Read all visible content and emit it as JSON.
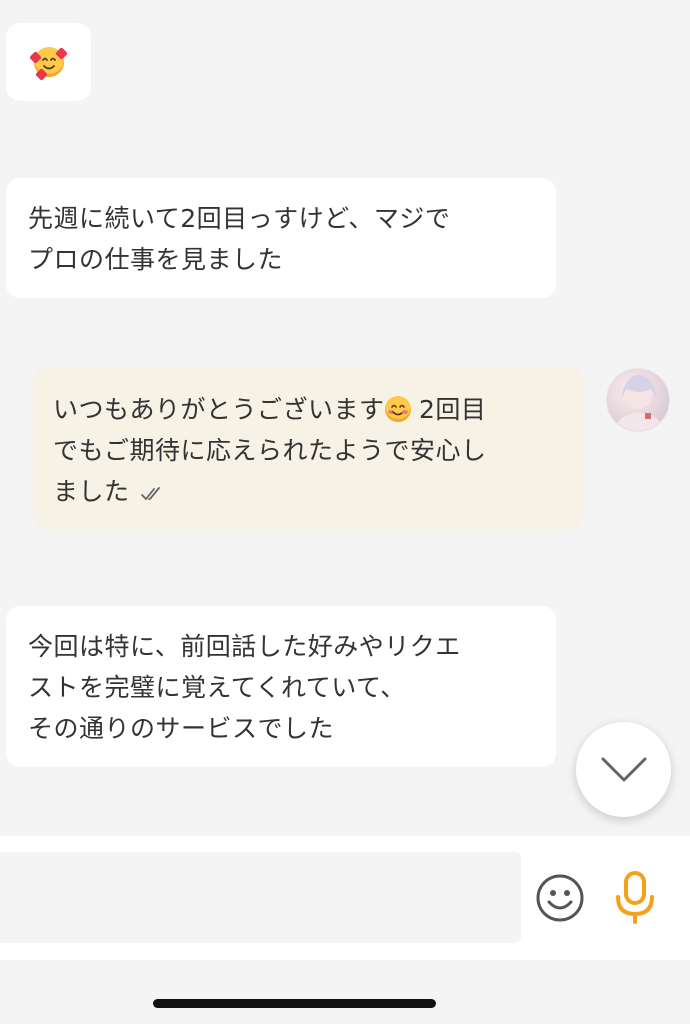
{
  "messages": [
    {
      "side": "incoming",
      "emoji": "smiling-face-with-hearts"
    },
    {
      "side": "incoming",
      "lines": [
        "先週に続いて2回目っすけど、マジで",
        "プロの仕事を見ました"
      ]
    },
    {
      "side": "outgoing",
      "line1_before_emoji": "いつもありがとうございます",
      "line1_emoji": "smiling-face-with-smiling-eyes",
      "line1_after_emoji": " 2回目",
      "line2": "でもご期待に応えられたようで安心し",
      "line3": "ました",
      "status": "read"
    },
    {
      "side": "incoming",
      "lines": [
        "今回は特に、前回話した好みやリクエ",
        "ストを完璧に覚えてくれていて、",
        "その通りのサービスでした"
      ]
    }
  ],
  "composer": {
    "value": "",
    "placeholder": ""
  },
  "icons": {
    "scroll_down": "chevron-down-icon",
    "emoji_picker": "smiley-icon",
    "voice_input": "microphone-icon"
  },
  "colors": {
    "incoming_bubble": "#ffffff",
    "outgoing_bubble": "#f6f2e6",
    "background": "#f4f4f4",
    "mic_accent": "#f5a11c",
    "smiley_icon": "#555555"
  }
}
